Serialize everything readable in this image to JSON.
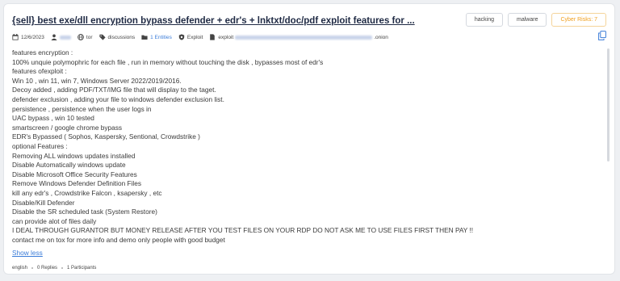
{
  "post": {
    "title": "{sell} best exe/dll encryption bypass defender + edr's + lnktxt/doc/pdf exploit features for ...",
    "tags": [
      "hacking",
      "malware",
      "Cyber Risks: 7"
    ],
    "colors": {
      "accent": "#3b7cd8",
      "risk": "#f0a020"
    },
    "meta": {
      "date": "12/6/2023",
      "network": "tor",
      "source": "discussions",
      "entities": "1 Entities",
      "type": "Exploit",
      "domain_prefix": "exploit",
      "domain_suffix": ".onion"
    },
    "body_lines": [
      "features encryption :",
      "100% unquie polymophric for each file , run in memory without touching the disk , bypasses most of edr's",
      "features ofexploit :",
      "Win 10 , win 11, win 7, Windows Server 2022/2019/2016.",
      "Decoy added , adding PDF/TXT/IMG file that will display to the taget.",
      "defender exclusion , adding your file to windows defender exclusion list.",
      "persistence , persistence when the user logs in",
      "UAC bypass , win 10 tested",
      "smartscreen / google chrome bypass",
      "EDR's Bypassed ( Sophos, Kaspersky, Sentional, Crowdstrike )",
      "optional Features :",
      "Removing ALL windows updates installed",
      "Disable Automatically windows update",
      "Disable Microsoft Office Security Features",
      "Remove Windows Defender Definition Files",
      "kill any edr's , Crowdstrike Falcon , ksapersky , etc",
      "Disable/Kill Defender",
      "Disable the SR scheduled task (System Restore)",
      "can provide alot of files daily",
      "I DEAL THROUGH GURANTOR BUT MONEY RELEASE AFTER YOU TEST FILES ON YOUR RDP DO NOT ASK ME TO USE FILES FIRST THEN PAY !!",
      "contact me on tox for more info and demo only people with good budget"
    ],
    "show_less": "Show less",
    "footer": {
      "language": "english",
      "replies": "0 Replies",
      "participants": "1 Participants"
    }
  }
}
